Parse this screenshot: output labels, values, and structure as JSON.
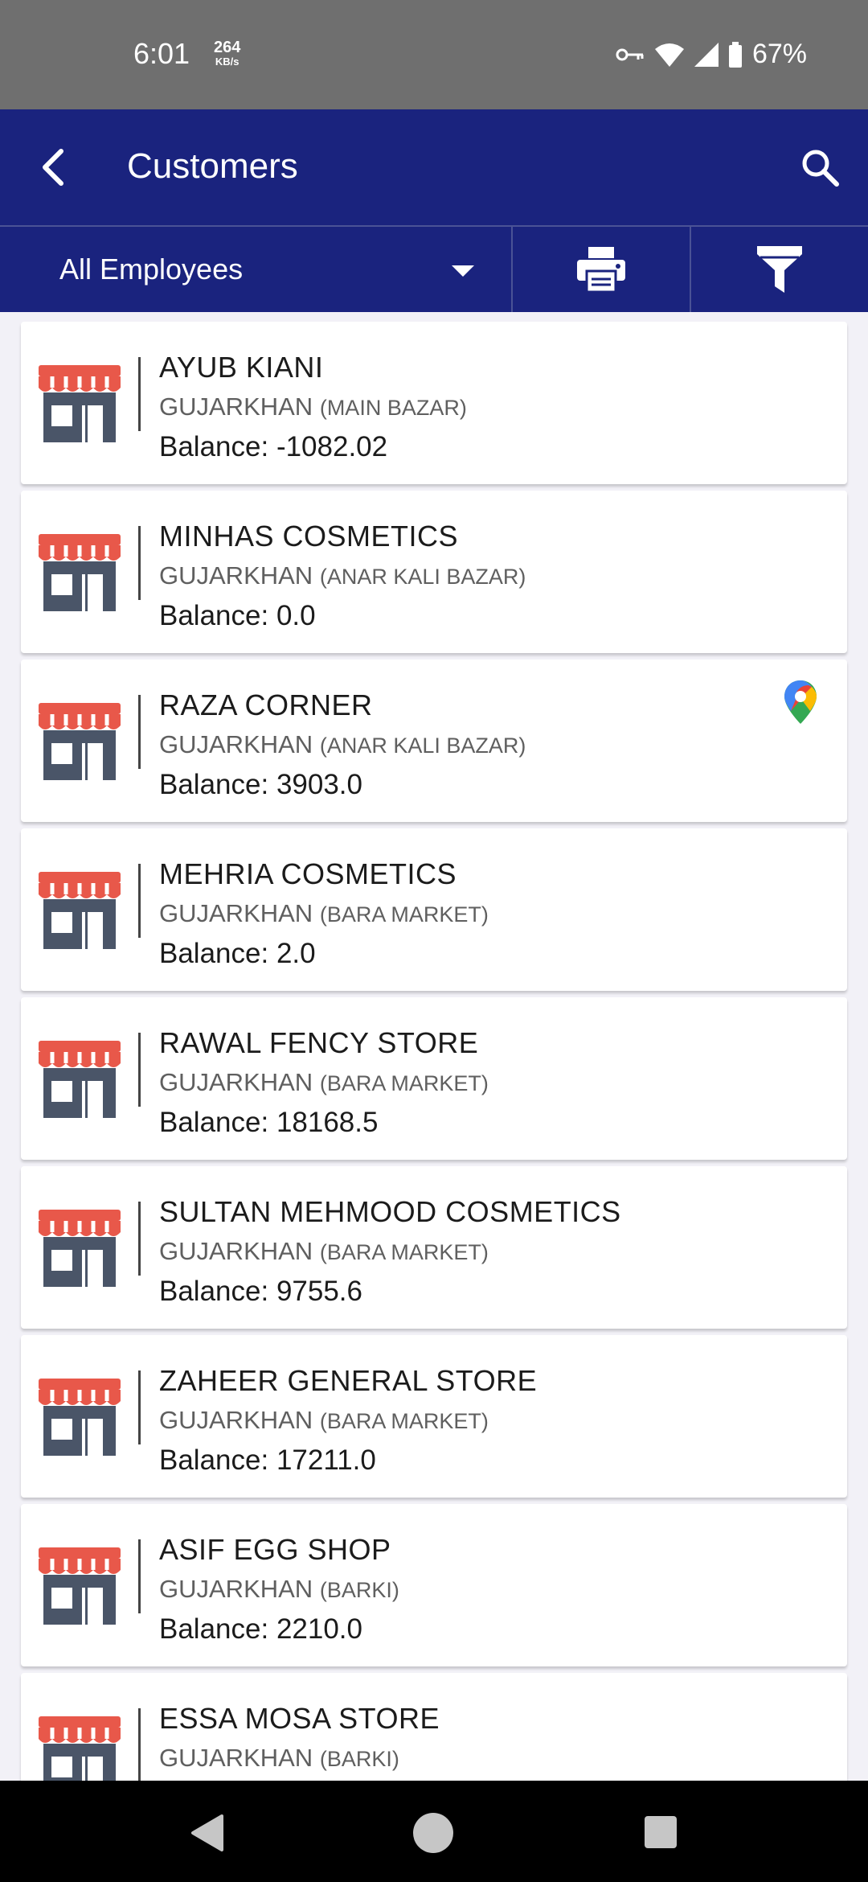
{
  "status_bar": {
    "time": "6:01",
    "net_speed": "264",
    "net_unit": "KB/s",
    "battery": "67%"
  },
  "app_bar": {
    "title": "Customers",
    "back_icon": "back-arrow-icon",
    "search_icon": "search-icon"
  },
  "filter_bar": {
    "employee_selected": "All Employees",
    "print_icon": "print-icon",
    "filter_icon": "filter-icon"
  },
  "balance_label": "Balance: ",
  "customers": [
    {
      "name": "AYUB KIANI",
      "city": "GUJARKHAN",
      "area": "(MAIN BAZAR)",
      "balance": "-1082.02",
      "has_location": false
    },
    {
      "name": "MINHAS COSMETICS",
      "city": "GUJARKHAN",
      "area": "(ANAR KALI BAZAR)",
      "balance": "0.0",
      "has_location": false
    },
    {
      "name": "RAZA CORNER",
      "city": "GUJARKHAN",
      "area": "(ANAR KALI BAZAR)",
      "balance": "3903.0",
      "has_location": true
    },
    {
      "name": "MEHRIA COSMETICS",
      "city": "GUJARKHAN",
      "area": "(BARA MARKET)",
      "balance": "2.0",
      "has_location": false
    },
    {
      "name": "RAWAL FENCY STORE",
      "city": "GUJARKHAN",
      "area": "(BARA MARKET)",
      "balance": "18168.5",
      "has_location": false
    },
    {
      "name": "SULTAN MEHMOOD COSMETICS",
      "city": "GUJARKHAN",
      "area": "(BARA MARKET)",
      "balance": "9755.6",
      "has_location": false
    },
    {
      "name": "ZAHEER GENERAL STORE",
      "city": "GUJARKHAN",
      "area": "(BARA MARKET)",
      "balance": "17211.0",
      "has_location": false
    },
    {
      "name": "ASIF EGG SHOP",
      "city": "GUJARKHAN",
      "area": "(BARKI)",
      "balance": "2210.0",
      "has_location": false
    },
    {
      "name": "ESSA MOSA STORE",
      "city": "GUJARKHAN",
      "area": "(BARKI)",
      "balance": "",
      "has_location": false
    }
  ],
  "colors": {
    "primary": "#1a237e",
    "status_bar": "#6f6f6f",
    "awning_red": "#e8584a",
    "shop_body": "#4a5568"
  }
}
